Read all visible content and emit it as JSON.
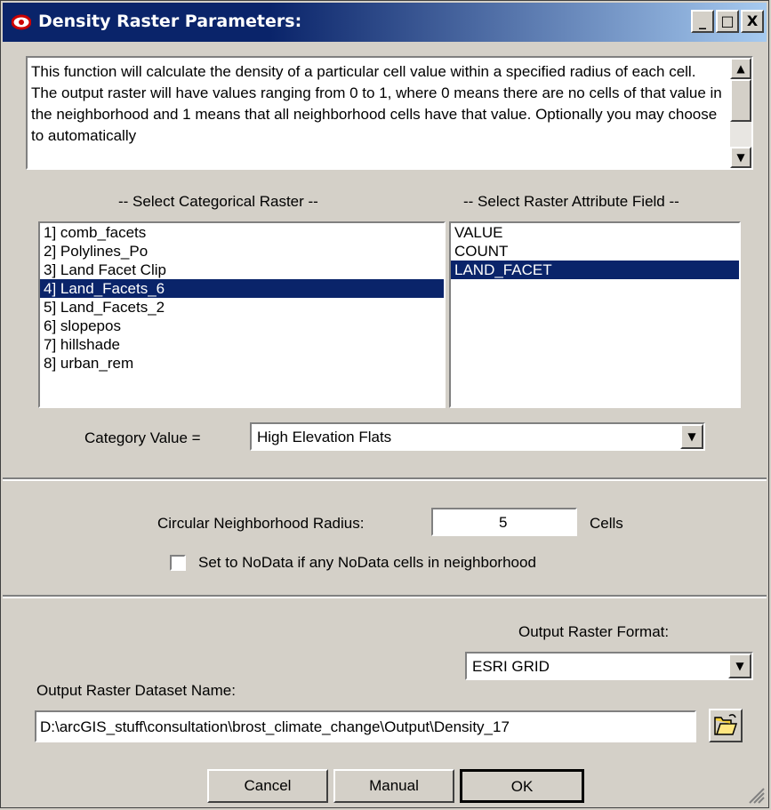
{
  "window": {
    "title": "Density Raster Parameters:",
    "buttons": {
      "minimize": "_",
      "maximize": "□",
      "close": "X"
    }
  },
  "description": "This function will calculate the density of a particular cell value within a specified radius of each cell.  The output raster will have values ranging from 0 to 1, where 0 means there are no cells of that value in the neighborhood and 1 means that all neighborhood cells have that value. Optionally you may choose to automatically",
  "raster_section": {
    "header": "-- Select Categorical Raster --",
    "items": [
      "1]  comb_facets",
      "2]  Polylines_Po",
      "3]  Land Facet Clip",
      "4]  Land_Facets_6",
      "5]  Land_Facets_2",
      "6]  slopepos",
      "7]  hillshade",
      "8]  urban_rem"
    ],
    "selected_index": 3
  },
  "field_section": {
    "header": "-- Select Raster Attribute Field --",
    "items": [
      "VALUE",
      "COUNT",
      "LAND_FACET"
    ],
    "selected_index": 2
  },
  "category": {
    "label": "Category Value =",
    "value": "High Elevation Flats"
  },
  "neighborhood": {
    "radius_label": "Circular Neighborhood Radius:",
    "radius_value": "5",
    "units": "Cells",
    "nodata_label": "Set to NoData if any NoData cells in neighborhood",
    "nodata_checked": false
  },
  "output": {
    "format_label": "Output Raster Format:",
    "format_value": "ESRI GRID",
    "name_label": "Output Raster Dataset Name:",
    "name_value": "D:\\arcGIS_stuff\\consultation\\brost_climate_change\\Output\\Density_17"
  },
  "footer": {
    "cancel": "Cancel",
    "manual": "Manual",
    "ok": "OK"
  },
  "colors": {
    "selection": "#0a246a",
    "face": "#d4d0c8"
  }
}
